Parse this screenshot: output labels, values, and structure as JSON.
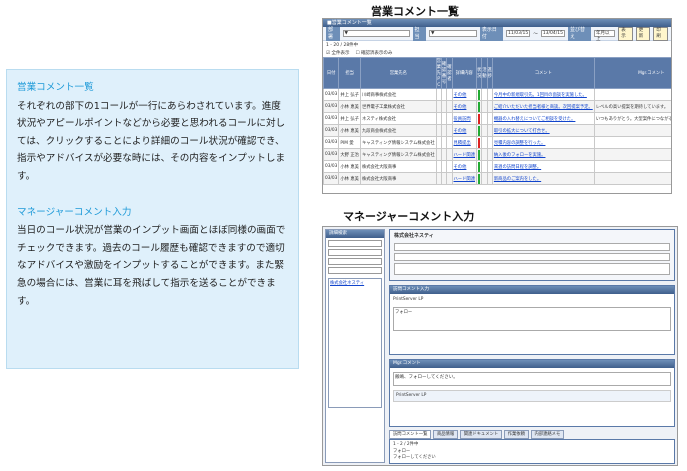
{
  "info": {
    "sales_heading": "営業コメント一覧",
    "sales_body": "それぞれの部下の1コールが一行にあらわされています。進度状況やアピールポイントなどから必要と思われるコールに対しては、クリックすることにより詳細のコール状況が確認でき、指示やアドバイスが必要な時には、その内容をインプットします。",
    "mgr_heading": "マネージャーコメント入力",
    "mgr_body": "当日のコール状況が営業のインプット画面とほぼ同様の画面でチェックできます。過去のコール履歴も確認できますので適切なアドバイスや激励をインプットすることができます。また緊急の場合には、営業に耳を飛ばして指示を送ることができます。"
  },
  "shot1": {
    "caption": "営業コメント一覧",
    "window_title": "■営業コメント一覧",
    "filter": {
      "dept_label": "部署",
      "staff_label": "担当",
      "period_label": "表示日付",
      "date_from": "11/03/15",
      "date_to": "13/04/15",
      "sort_label": "並び替え",
      "order_value": "年月以上",
      "buttons": [
        "表示",
        "更新",
        "印刷"
      ]
    },
    "count_text": "1 - 20 / 28件中",
    "checks": [
      "全件表示",
      "確認済表示のみ"
    ],
    "columns": [
      "日付",
      "担当",
      "営業先名",
      "営業先ＰＣ",
      "確認番号",
      "確認者",
      "詳細内容",
      "状況",
      "活動",
      "進捗",
      "コメント",
      "Mgr.コメント",
      "確認"
    ],
    "rows": [
      {
        "date": "03/03",
        "staff": "井上 弘子",
        "client": "川崎商事株式会社",
        "detail": "その他",
        "status": "#22aa33",
        "note": "今月中の新規取引先。1回目の面談を実施した。",
        "mgr": ""
      },
      {
        "date": "03/03",
        "staff": "小林 恵美",
        "client": "世界電子工業株式会社",
        "detail": "その他",
        "status": "#22aa33",
        "note": "ご紹介いただいた担当者様と商談。次回提案予定。",
        "mgr": "レベルの高い提案を期待しています。"
      },
      {
        "date": "03/03",
        "staff": "井上 弘子",
        "client": "ネスティ株式会社",
        "detail": "役員訪問",
        "status": "#dd2222",
        "note": "機器の入れ替えについてご相談を受けた。",
        "mgr": "いつもありがとう。大型案件につながるように頑張って。"
      },
      {
        "date": "03/03",
        "staff": "小林 恵美",
        "client": "九段商会株式会社",
        "detail": "その他",
        "status": "#22aa33",
        "note": "取引の拡大について打合せ。",
        "mgr": ""
      },
      {
        "date": "03/03",
        "staff": "PIM 愛",
        "client": "キャスティング情報システム株式会社",
        "detail": "見積提出",
        "status": "#dd2222",
        "note": "見積内容の調整を行った。",
        "mgr": ""
      },
      {
        "date": "03/03",
        "staff": "大野 正治",
        "client": "キャスティング情報システム株式会社",
        "detail": "ハード関連",
        "status": "#22aa33",
        "note": "納入後のフォローを実施。",
        "mgr": ""
      },
      {
        "date": "03/03",
        "staff": "小林 恵美",
        "client": "株式会社大阪商事",
        "detail": "その他",
        "status": "#22aa33",
        "note": "来週の訪問日程を調整。",
        "mgr": ""
      },
      {
        "date": "03/03",
        "staff": "小林 恵美",
        "client": "株式会社大阪商事",
        "detail": "ハード関連",
        "status": "#22aa33",
        "note": "新商品のご案内をした。",
        "mgr": ""
      }
    ]
  },
  "shot2": {
    "caption": "マネージャーコメント入力",
    "search_title": "詳細検索",
    "company": "株式会社ネスティ",
    "call_title": "訪問コメント入力",
    "mgr_title": "Mgr.コメント",
    "mgr_text": "飯嶋、フォローしてください。",
    "product": "PrintServer LP",
    "sidebar_item": "株式会社ネスティ",
    "tabs": [
      "訪問コメント一覧",
      "商品情報",
      "関連ドキュメント",
      "作業依頼",
      "内部連絡メモ"
    ],
    "history_count": "1 - 2 / 2件中",
    "follow_text": "フォロー",
    "history": [
      "フォロー",
      "フォローしてください",
      "PrintServer LP"
    ]
  }
}
